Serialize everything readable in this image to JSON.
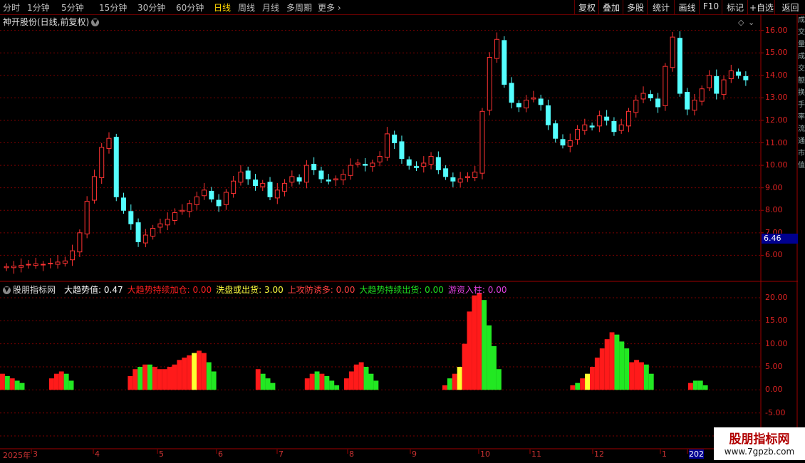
{
  "toolbar": {
    "periods": [
      "分时",
      "1分钟",
      "5分钟",
      "15分钟",
      "30分钟",
      "60分钟",
      "日线",
      "周线",
      "月线",
      "多周期",
      "更多"
    ],
    "active_period": "日线",
    "actions": [
      "复权",
      "叠加",
      "多股",
      "统计",
      "画线",
      "F10",
      "标记",
      "+自选",
      "返回"
    ]
  },
  "stock": {
    "title": "神开股份(日线,前复权)"
  },
  "price_axis": {
    "ticks": [
      "16.00",
      "15.00",
      "14.00",
      "13.00",
      "12.00",
      "11.00",
      "10.00",
      "9.00",
      "8.00",
      "7.00",
      "6.00"
    ],
    "current": "6.46"
  },
  "indicator": {
    "name": "股朋指标网",
    "items": [
      {
        "label": "大趋势值:",
        "value": "0.47",
        "color": "#ffffff"
      },
      {
        "label": "大趋势持续加仓:",
        "value": "0.00",
        "color": "#ff2020"
      },
      {
        "label": "洗盘或出货:",
        "value": "3.00",
        "color": "#ffff40"
      },
      {
        "label": "上攻防诱多:",
        "value": "0.00",
        "color": "#ff4040"
      },
      {
        "label": "大趋势持续出货:",
        "value": "0.00",
        "color": "#20e020"
      },
      {
        "label": "游资入柱:",
        "value": "0.00",
        "color": "#e040e0"
      }
    ],
    "axis_ticks": [
      "20.00",
      "15.00",
      "10.00",
      "5.00",
      "0.00",
      "-5.00",
      "-10.00"
    ]
  },
  "date_axis": [
    "2025年",
    "3",
    "4",
    "5",
    "6",
    "7",
    "8",
    "9",
    "10",
    "11",
    "12",
    "1",
    "202"
  ],
  "right_strip": "成交量成交额换手率流通市值",
  "watermark": {
    "line1": "股朋指标网",
    "line2": "www.7gpzb.com"
  },
  "colors": {
    "up": "#ff3232",
    "down": "#54ffff",
    "grid": "#7a0000",
    "bar_red": "#ff1a1a",
    "bar_green": "#22e822",
    "bar_yellow": "#ffff30"
  },
  "chart_data": [
    {
      "type": "candlestick",
      "title": "神开股份(日线,前复权)",
      "ylim": [
        5.0,
        16.4
      ],
      "ohlc_close_series": [
        5.5,
        5.52,
        5.55,
        5.6,
        5.62,
        5.6,
        5.65,
        5.7,
        5.75,
        6.2,
        7.0,
        8.4,
        9.5,
        10.8,
        11.2,
        8.6,
        8.0,
        7.4,
        6.6,
        6.9,
        7.2,
        7.4,
        7.6,
        7.9,
        8.0,
        8.3,
        8.6,
        8.9,
        8.5,
        8.2,
        8.8,
        9.3,
        9.7,
        9.4,
        9.1,
        9.2,
        8.6,
        8.9,
        9.2,
        9.5,
        9.3,
        10.0,
        9.8,
        9.4,
        9.3,
        9.4,
        9.6,
        10.0,
        10.1,
        10.0,
        10.1,
        10.4,
        11.4,
        11.0,
        10.3,
        10.0,
        9.9,
        10.1,
        10.4,
        9.8,
        9.5,
        9.3,
        9.4,
        9.5,
        9.7,
        12.4,
        14.8,
        15.6,
        13.6,
        12.8,
        12.6,
        12.9,
        13.0,
        12.7,
        11.8,
        11.2,
        10.9,
        11.1,
        11.6,
        11.8,
        11.7,
        12.2,
        12.0,
        11.5,
        11.8,
        12.4,
        12.9,
        13.2,
        13.0,
        12.6,
        14.4,
        15.7,
        13.2,
        12.5,
        12.9,
        13.4,
        14.0,
        13.2,
        13.8,
        14.2,
        14.0,
        13.8
      ]
    },
    {
      "type": "bar",
      "title": "股朋指标网",
      "ylim": [
        -12,
        22
      ],
      "note": "indicator columns",
      "groups": [
        {
          "start": 0,
          "values": [
            3.5,
            3,
            2.5,
            2,
            1.5
          ],
          "colors": [
            "r",
            "g",
            "r",
            "g",
            "g"
          ]
        },
        {
          "start": 10,
          "values": [
            2.5,
            3.5,
            4,
            3.5,
            2
          ],
          "colors": [
            "r",
            "r",
            "r",
            "g",
            "g"
          ]
        },
        {
          "start": 26,
          "values": [
            3,
            4.5,
            5,
            5.5,
            5.5,
            5,
            4.5,
            4.5,
            5,
            5.5,
            6.5,
            7,
            7.5,
            8,
            8.5,
            8,
            6,
            4
          ],
          "colors": [
            "r",
            "r",
            "g",
            "r",
            "g",
            "r",
            "r",
            "r",
            "r",
            "r",
            "r",
            "r",
            "r",
            "y",
            "r",
            "r",
            "g",
            "g"
          ]
        },
        {
          "start": 52,
          "values": [
            4.5,
            3.5,
            2.5,
            1.5
          ],
          "colors": [
            "r",
            "g",
            "g",
            "g"
          ]
        },
        {
          "start": 62,
          "values": [
            2.5,
            3.5,
            4,
            3.5,
            3,
            2,
            1
          ],
          "colors": [
            "r",
            "r",
            "g",
            "r",
            "g",
            "g",
            "g"
          ]
        },
        {
          "start": 70,
          "values": [
            2.5,
            4,
            5.5,
            6,
            5,
            3.5,
            2
          ],
          "colors": [
            "r",
            "r",
            "r",
            "r",
            "g",
            "g",
            "g"
          ]
        },
        {
          "start": 90,
          "values": [
            1,
            2.5,
            3.5,
            5,
            10,
            17,
            20.5,
            21,
            19.5,
            14,
            9.5,
            4.5
          ],
          "colors": [
            "r",
            "g",
            "r",
            "y",
            "r",
            "r",
            "r",
            "r",
            "g",
            "g",
            "g",
            "g"
          ]
        },
        {
          "start": 116,
          "values": [
            1,
            1.5,
            2.5,
            3.5,
            5,
            7,
            9,
            11,
            12.5,
            12,
            10.5,
            9,
            6,
            6.5,
            6,
            5.5,
            3.5
          ],
          "colors": [
            "r",
            "g",
            "r",
            "y",
            "r",
            "r",
            "r",
            "r",
            "r",
            "g",
            "g",
            "g",
            "r",
            "r",
            "r",
            "g",
            "g"
          ]
        },
        {
          "start": 140,
          "values": [
            1.5,
            2,
            2,
            1
          ],
          "colors": [
            "r",
            "g",
            "g",
            "g"
          ]
        }
      ]
    }
  ]
}
